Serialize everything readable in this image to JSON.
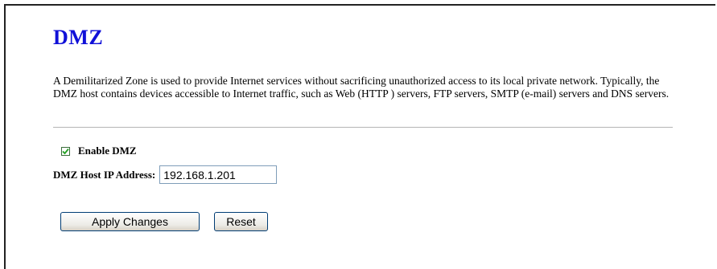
{
  "page": {
    "title": "DMZ",
    "description": "A Demilitarized Zone is used to provide Internet services without sacrificing unauthorized access to its local private network. Typically, the DMZ host contains devices accessible to Internet traffic, such as Web (HTTP ) servers, FTP servers, SMTP (e-mail) servers and DNS servers."
  },
  "form": {
    "enable_dmz": {
      "label": "Enable DMZ",
      "checked": true
    },
    "host_ip": {
      "label": "DMZ Host IP Address:",
      "value": "192.168.1.201"
    }
  },
  "buttons": {
    "apply_label": "Apply Changes",
    "reset_label": "Reset"
  },
  "icons": {
    "checkbox": "checkmark-icon"
  },
  "colors": {
    "title": "#1010d8",
    "checkmark": "#21a121"
  }
}
